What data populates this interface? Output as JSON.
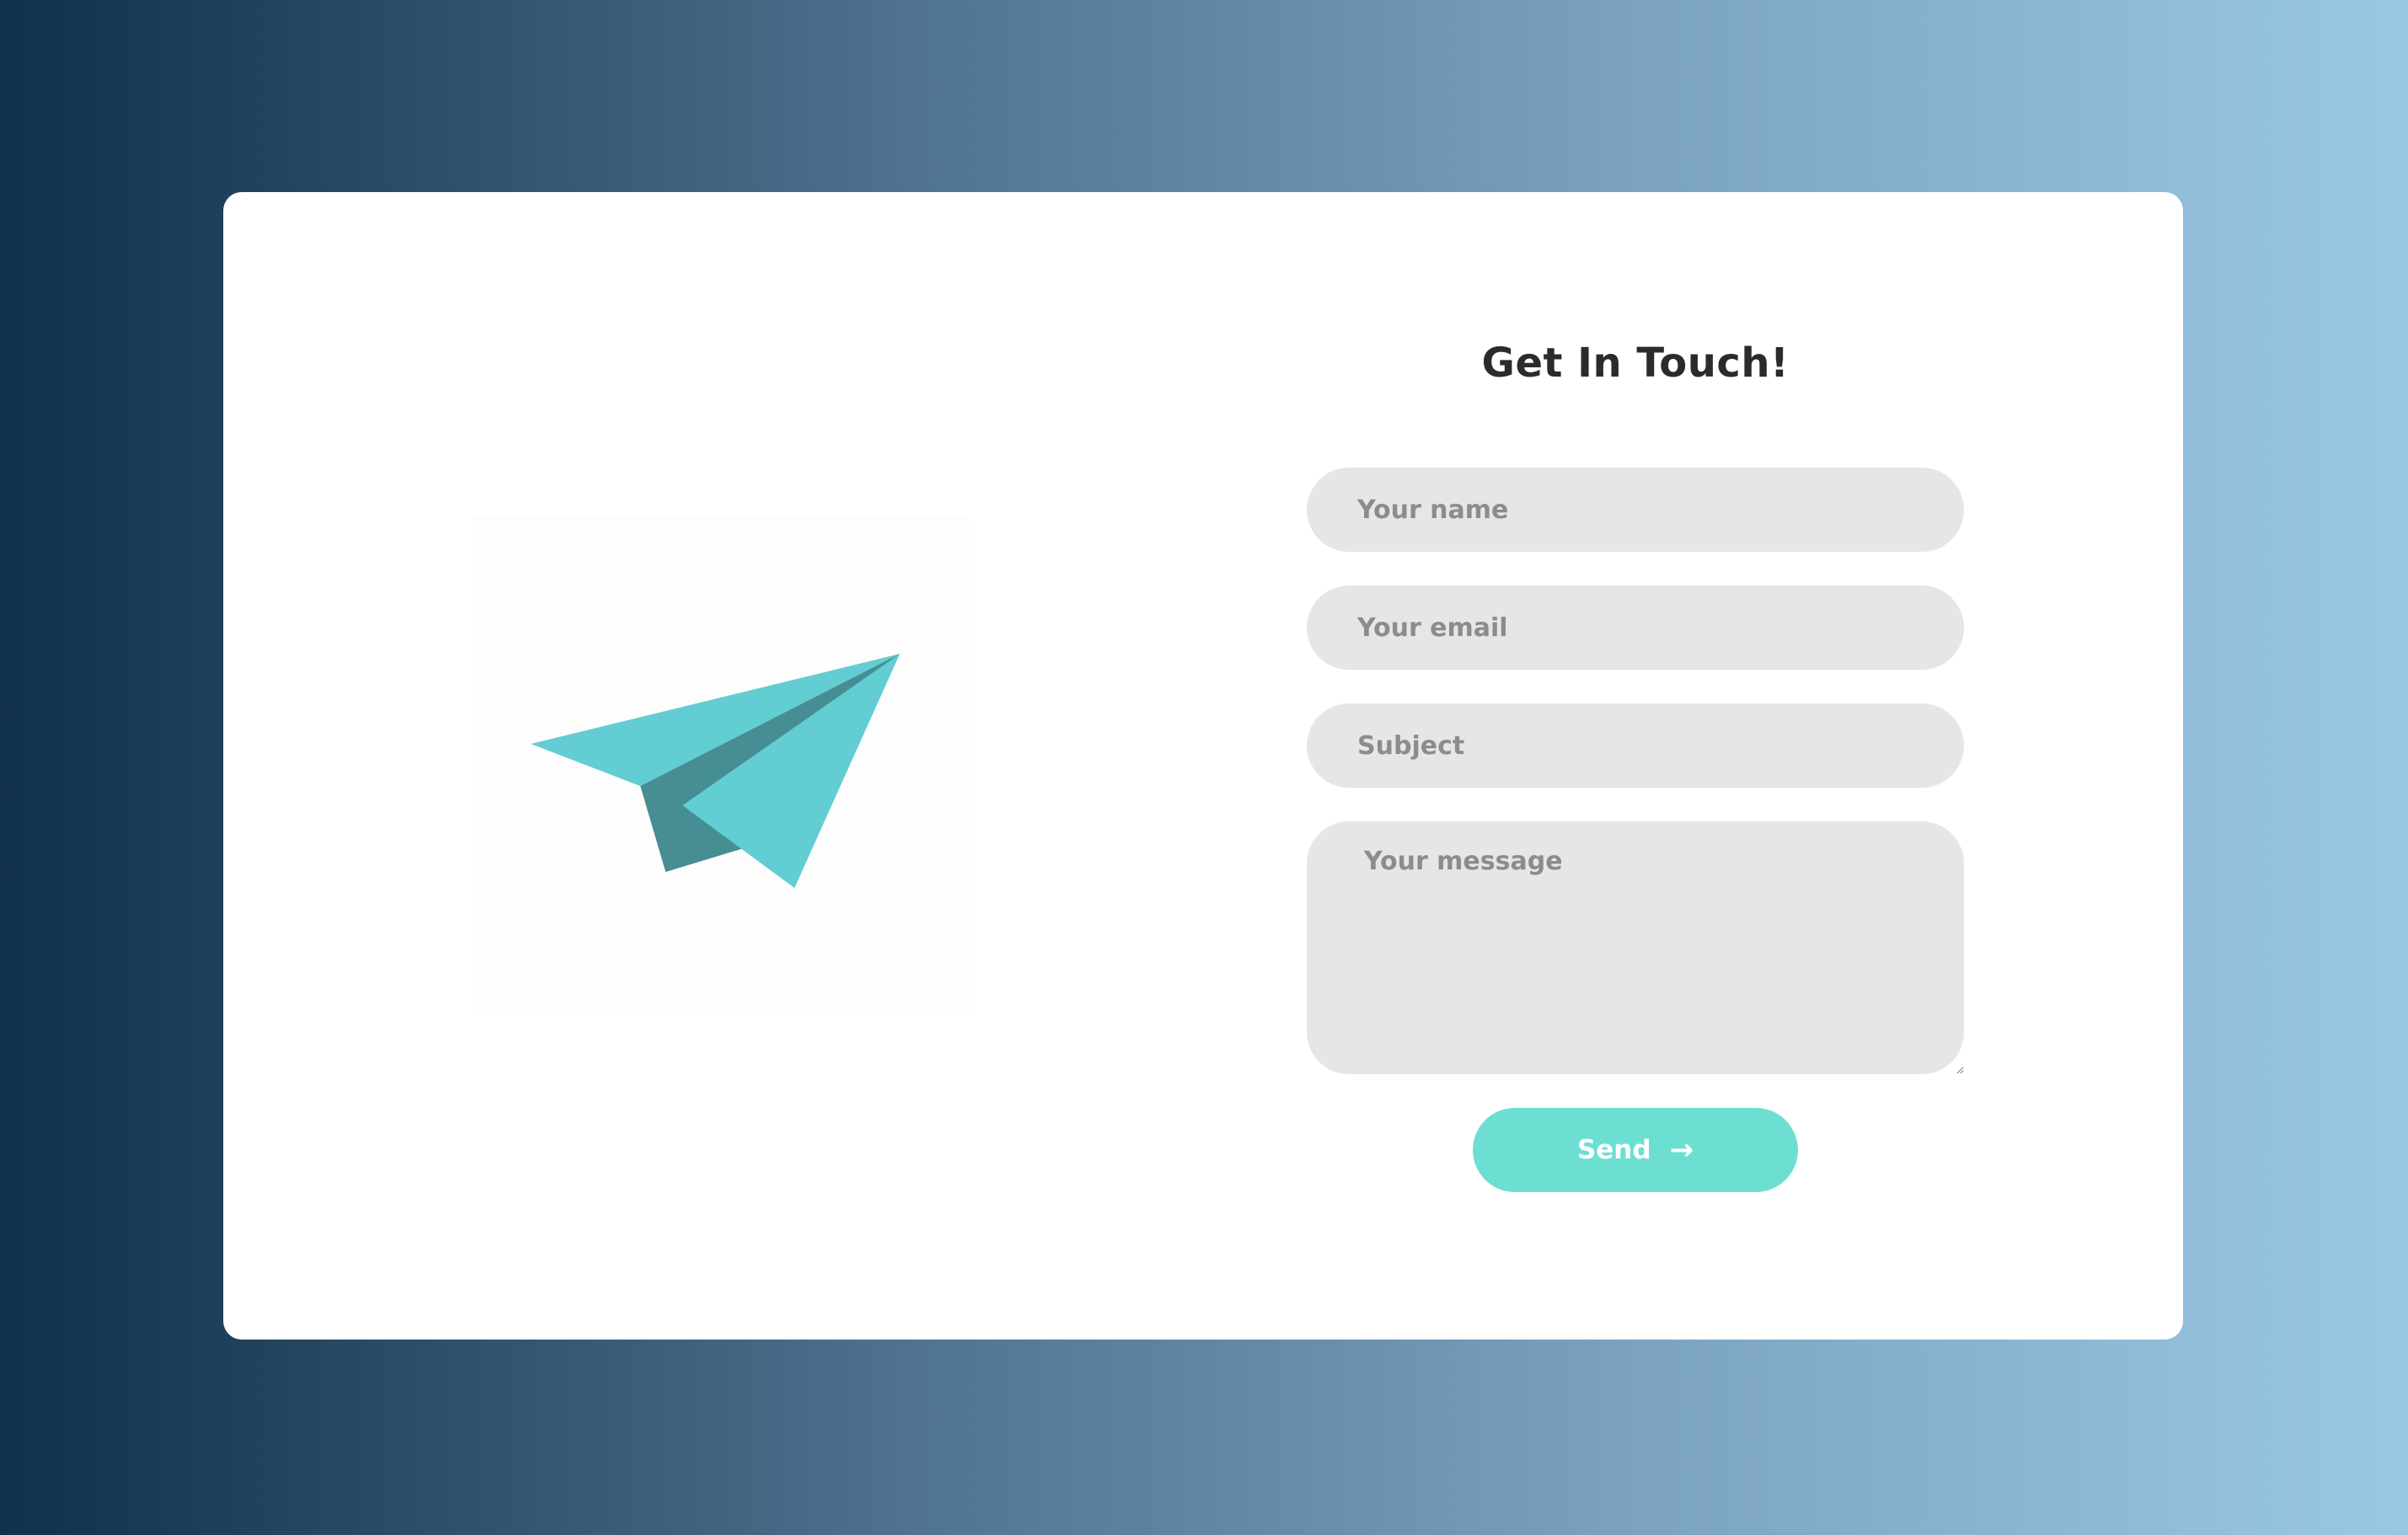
{
  "form": {
    "title": "Get In Touch!",
    "name_placeholder": "Your name",
    "email_placeholder": "Your email",
    "subject_placeholder": "Subject",
    "message_placeholder": "Your message",
    "send_label": "Send",
    "send_icon": "→"
  },
  "illustration": {
    "icon": "paper-plane-icon"
  },
  "colors": {
    "accent": "#6ddfd2",
    "plane_light": "#62cdd2",
    "plane_dark": "#468e93",
    "field_background": "#e6e6e6",
    "placeholder_text": "#8c8c8c",
    "title_text": "#2b2b2b",
    "background_gradient_start": "#11304a",
    "background_gradient_end": "#9ac8e4"
  }
}
